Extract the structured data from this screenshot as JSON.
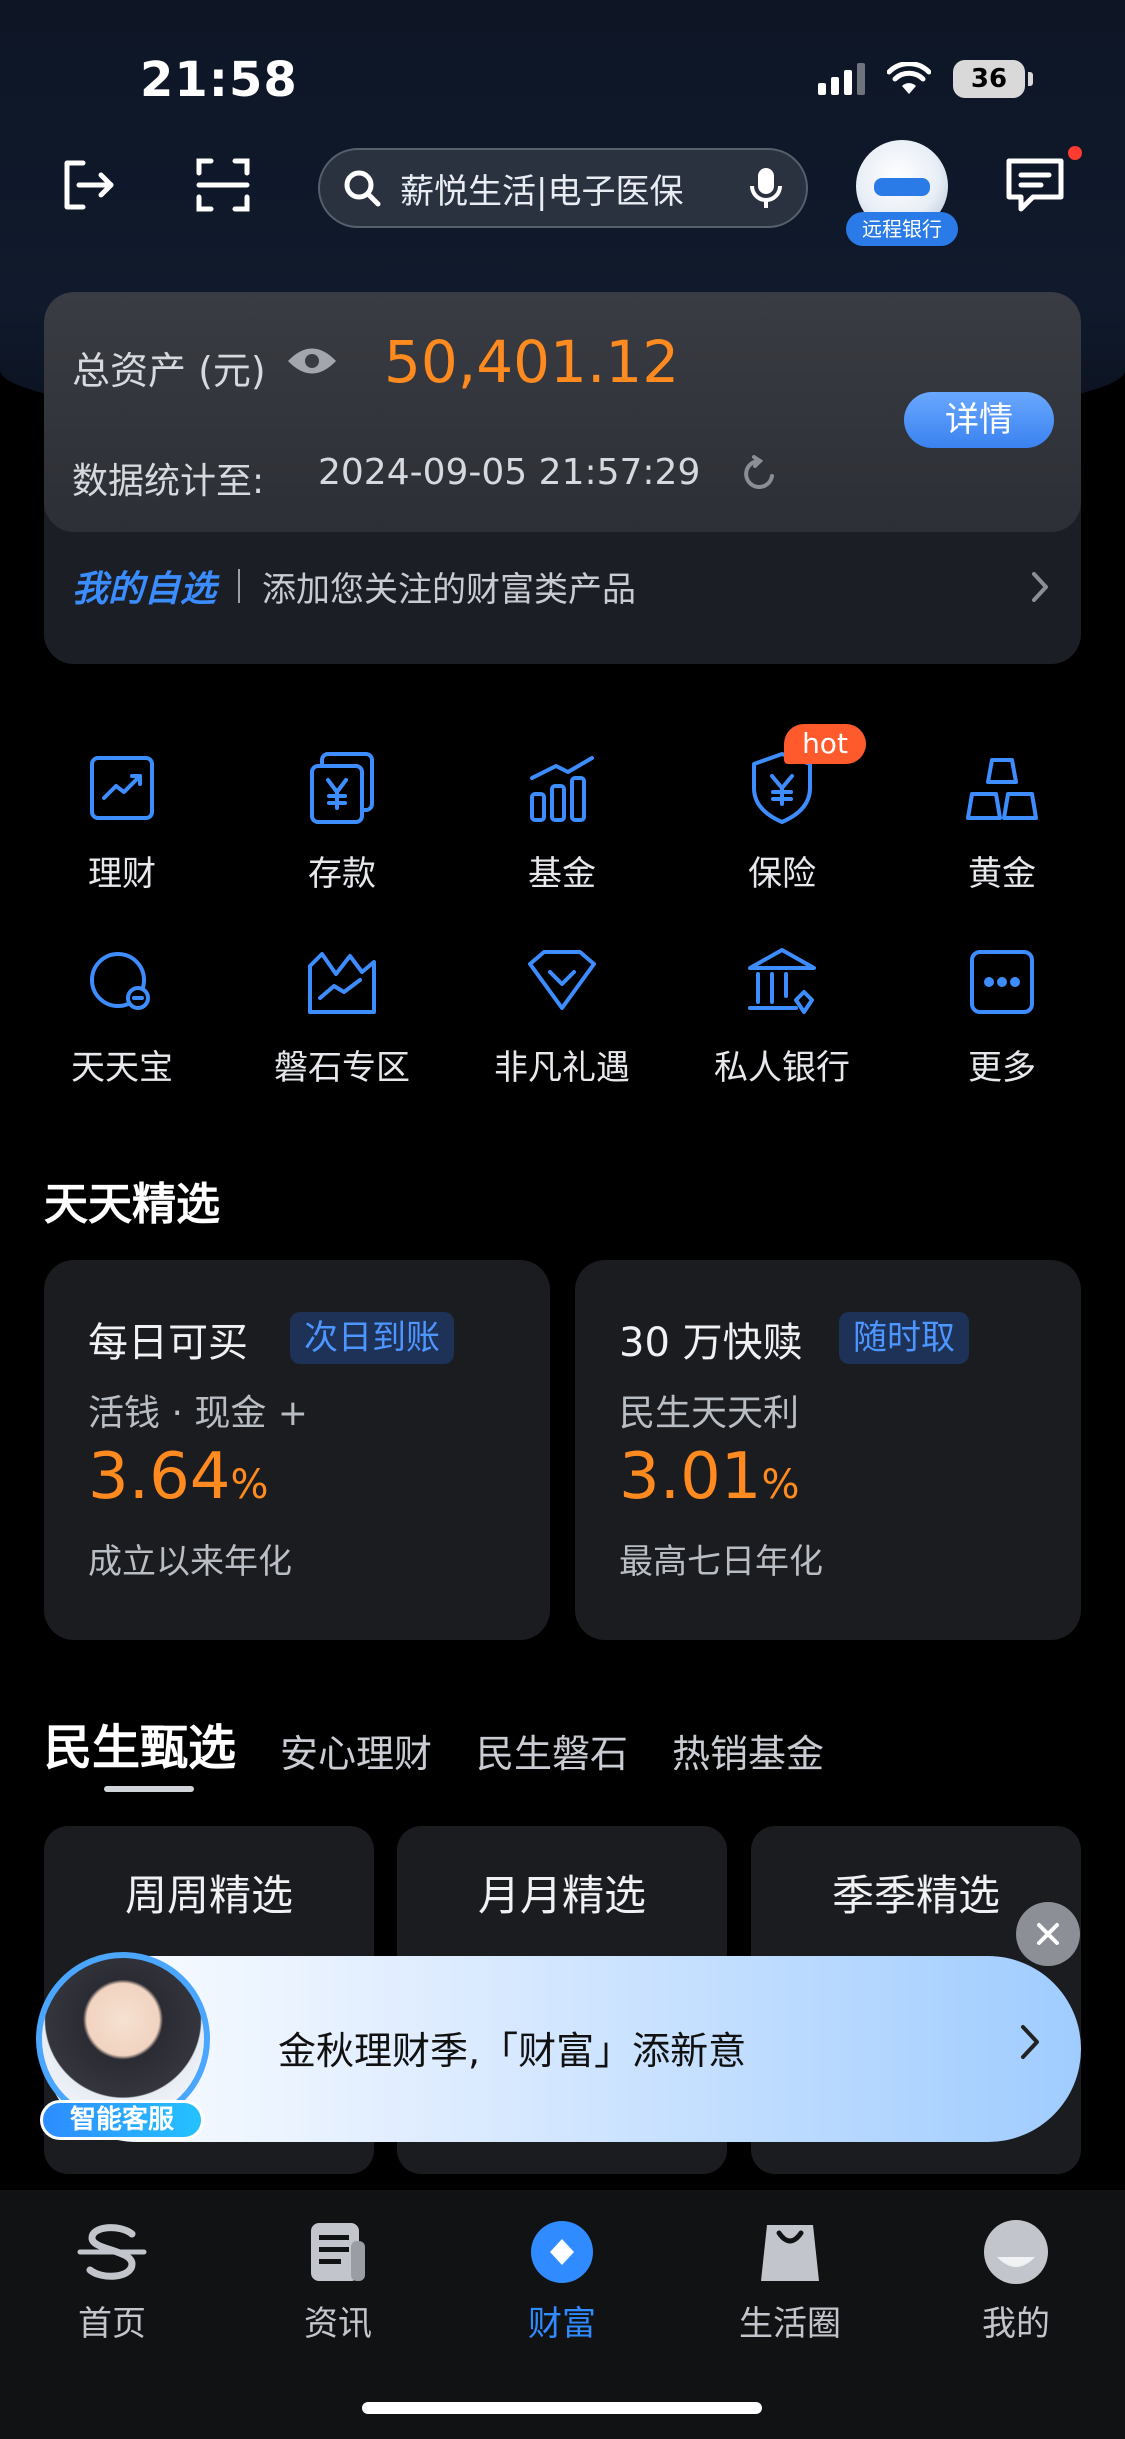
{
  "status_bar": {
    "time": "21:58",
    "battery": "36"
  },
  "top_bar": {
    "search_text": "薪悦生活|电子医保",
    "avatar_tag": "远程银行"
  },
  "asset": {
    "label": "总资产 (元)",
    "value": "50,401.12",
    "detail_button": "详情",
    "stats_label": "数据统计至:",
    "stats_time": "2024-09-05 21:57:29",
    "favorites_title": "我的自选",
    "favorites_desc": "添加您关注的财富类产品"
  },
  "grid": [
    {
      "label": "理财",
      "icon": "chart-icon"
    },
    {
      "label": "存款",
      "icon": "deposit-icon"
    },
    {
      "label": "基金",
      "icon": "fund-icon"
    },
    {
      "label": "保险",
      "icon": "insurance-icon",
      "badge": "hot"
    },
    {
      "label": "黄金",
      "icon": "gold-icon"
    },
    {
      "label": "天天宝",
      "icon": "tiantianbao-icon"
    },
    {
      "label": "磐石专区",
      "icon": "panshi-icon"
    },
    {
      "label": "非凡礼遇",
      "icon": "gift-icon"
    },
    {
      "label": "私人银行",
      "icon": "private-bank-icon"
    },
    {
      "label": "更多",
      "icon": "more-icon"
    }
  ],
  "daily": {
    "title": "天天精选",
    "cards": [
      {
        "title": "每日可买",
        "badge": "次日到账",
        "sub": "活钱 · 现金 +",
        "rate": "3.64",
        "pct": "%",
        "desc": "成立以来年化"
      },
      {
        "title": "30 万快赎",
        "badge": "随时取",
        "sub": "民生天天利",
        "rate": "3.01",
        "pct": "%",
        "desc": "最高七日年化"
      }
    ]
  },
  "tabs": [
    "民生甄选",
    "安心理财",
    "民生磐石",
    "热销基金"
  ],
  "products": [
    "周周精选",
    "月月精选",
    "季季精选"
  ],
  "banner": {
    "text": "金秋理财季,「财富」添新意",
    "agent_tag": "智能客服"
  },
  "bottom_nav": [
    {
      "label": "首页",
      "icon": "cmbc-logo-icon"
    },
    {
      "label": "资讯",
      "icon": "news-icon"
    },
    {
      "label": "财富",
      "icon": "wealth-icon",
      "active": true
    },
    {
      "label": "生活圈",
      "icon": "bag-icon"
    },
    {
      "label": "我的",
      "icon": "profile-icon"
    }
  ],
  "colors": {
    "accent_blue": "#2f8bff",
    "accent_orange": "#ff8a1f",
    "hot_red": "#ff5a2c"
  }
}
